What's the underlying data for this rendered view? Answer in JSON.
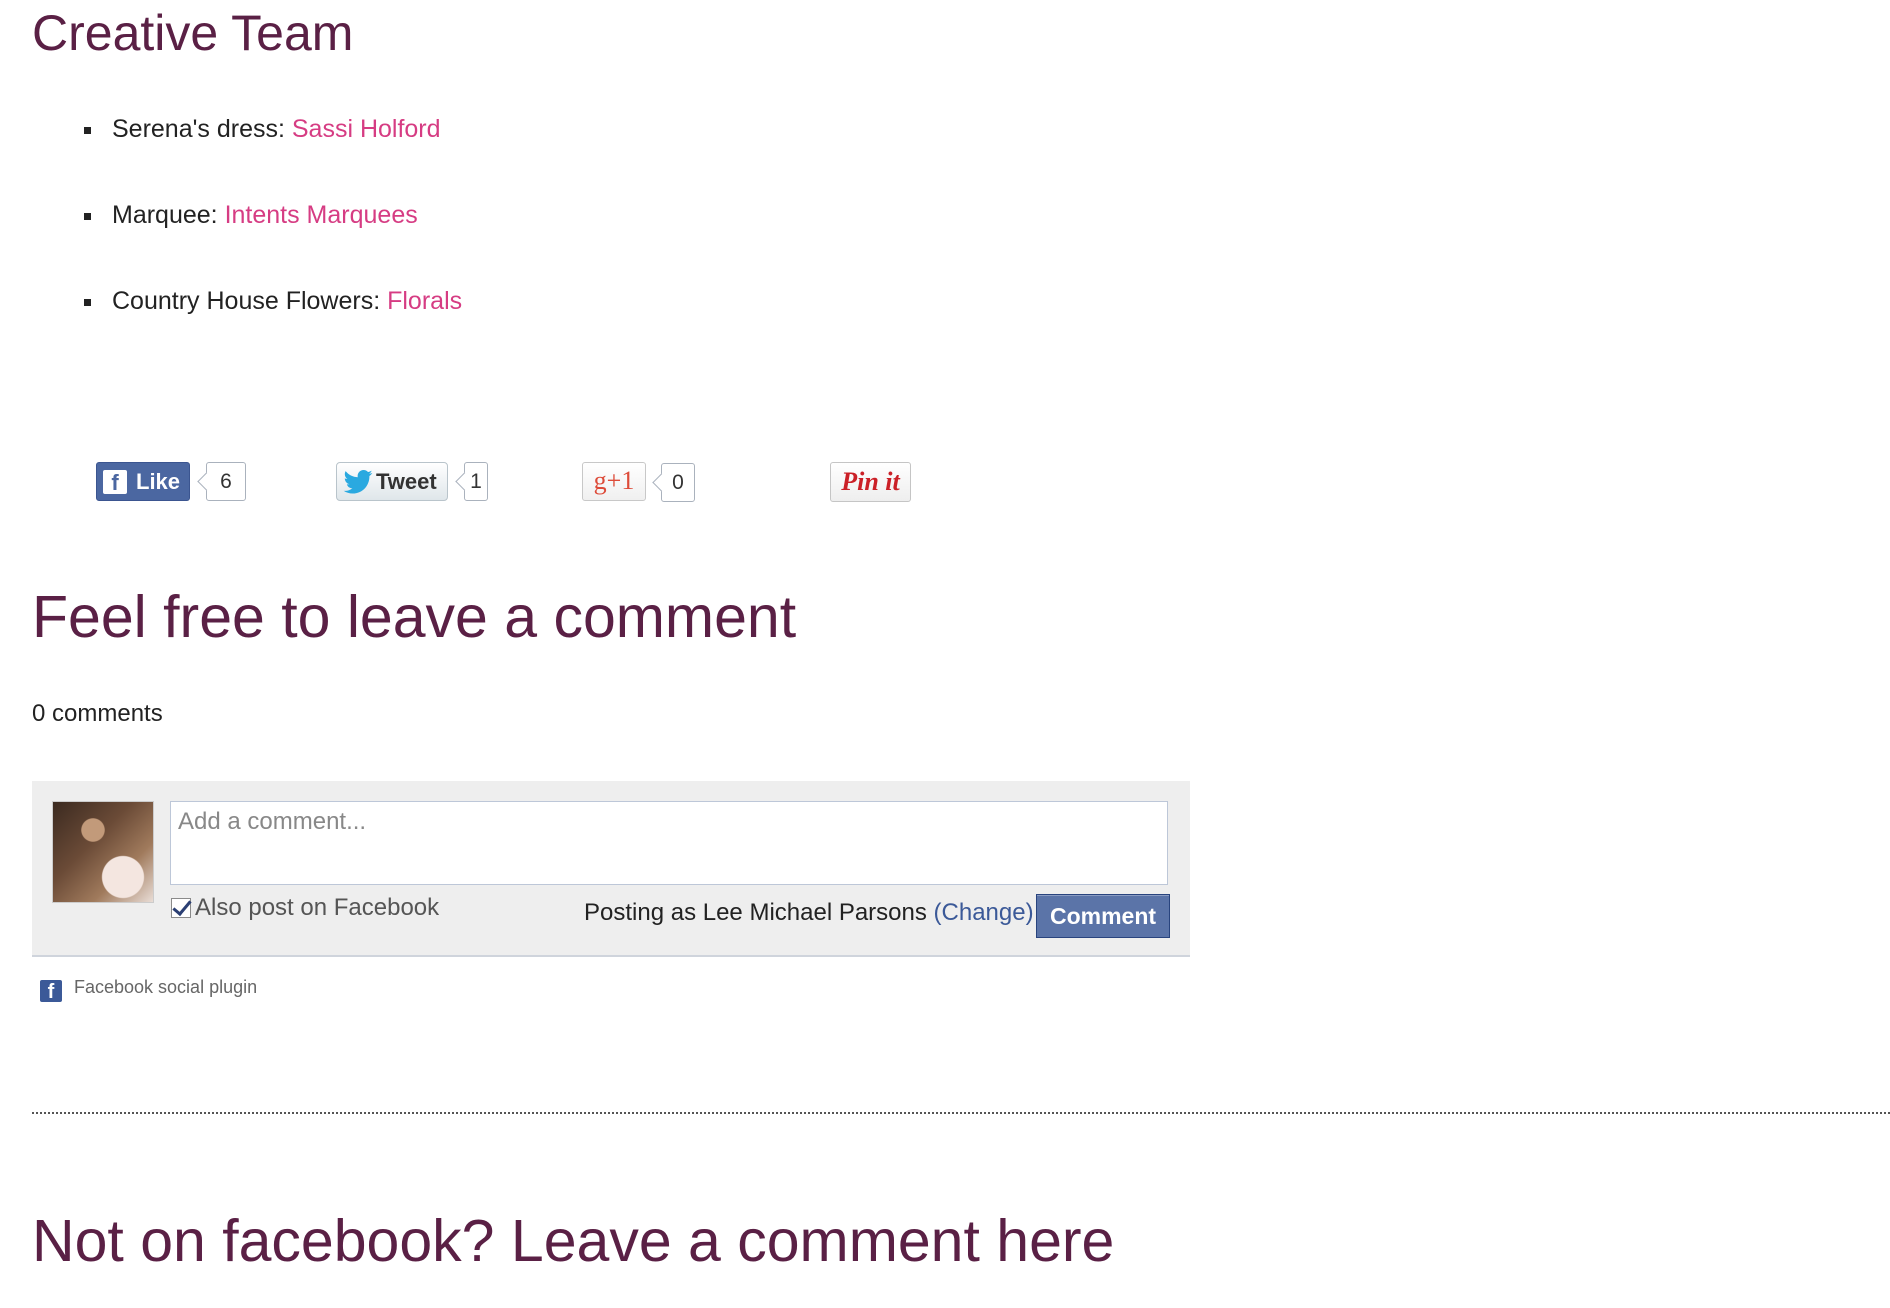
{
  "creative_team": {
    "heading": "Creative Team",
    "items": [
      {
        "label": "Serena's dress: ",
        "link": "Sassi Holford"
      },
      {
        "label": "Marquee: ",
        "link": "Intents Marquees"
      },
      {
        "label": "Country House Flowers: ",
        "link": "Florals"
      }
    ]
  },
  "share": {
    "facebook": {
      "label": "Like",
      "icon": "facebook-f-icon",
      "count": "6"
    },
    "twitter": {
      "label": "Tweet",
      "icon": "twitter-bird-icon",
      "count": "1"
    },
    "google_plus": {
      "label": "g+1",
      "count": "0"
    },
    "pinterest": {
      "label": "Pin it"
    }
  },
  "comments_section": {
    "heading": "Feel free to leave a comment",
    "count_text": "0 comments",
    "input_placeholder": "Add a comment...",
    "also_post_label": "Also post on Facebook",
    "also_post_checked": true,
    "posting_as_prefix": "Posting as Lee Michael Parsons ",
    "change_link": "(Change)",
    "submit_label": "Comment",
    "plugin_note": "Facebook social plugin"
  },
  "alt_comments": {
    "heading": "Not on facebook? Leave a comment here"
  },
  "colors": {
    "heading": "#5a2045",
    "link": "#d63c83",
    "facebook_blue": "#3b5998"
  }
}
